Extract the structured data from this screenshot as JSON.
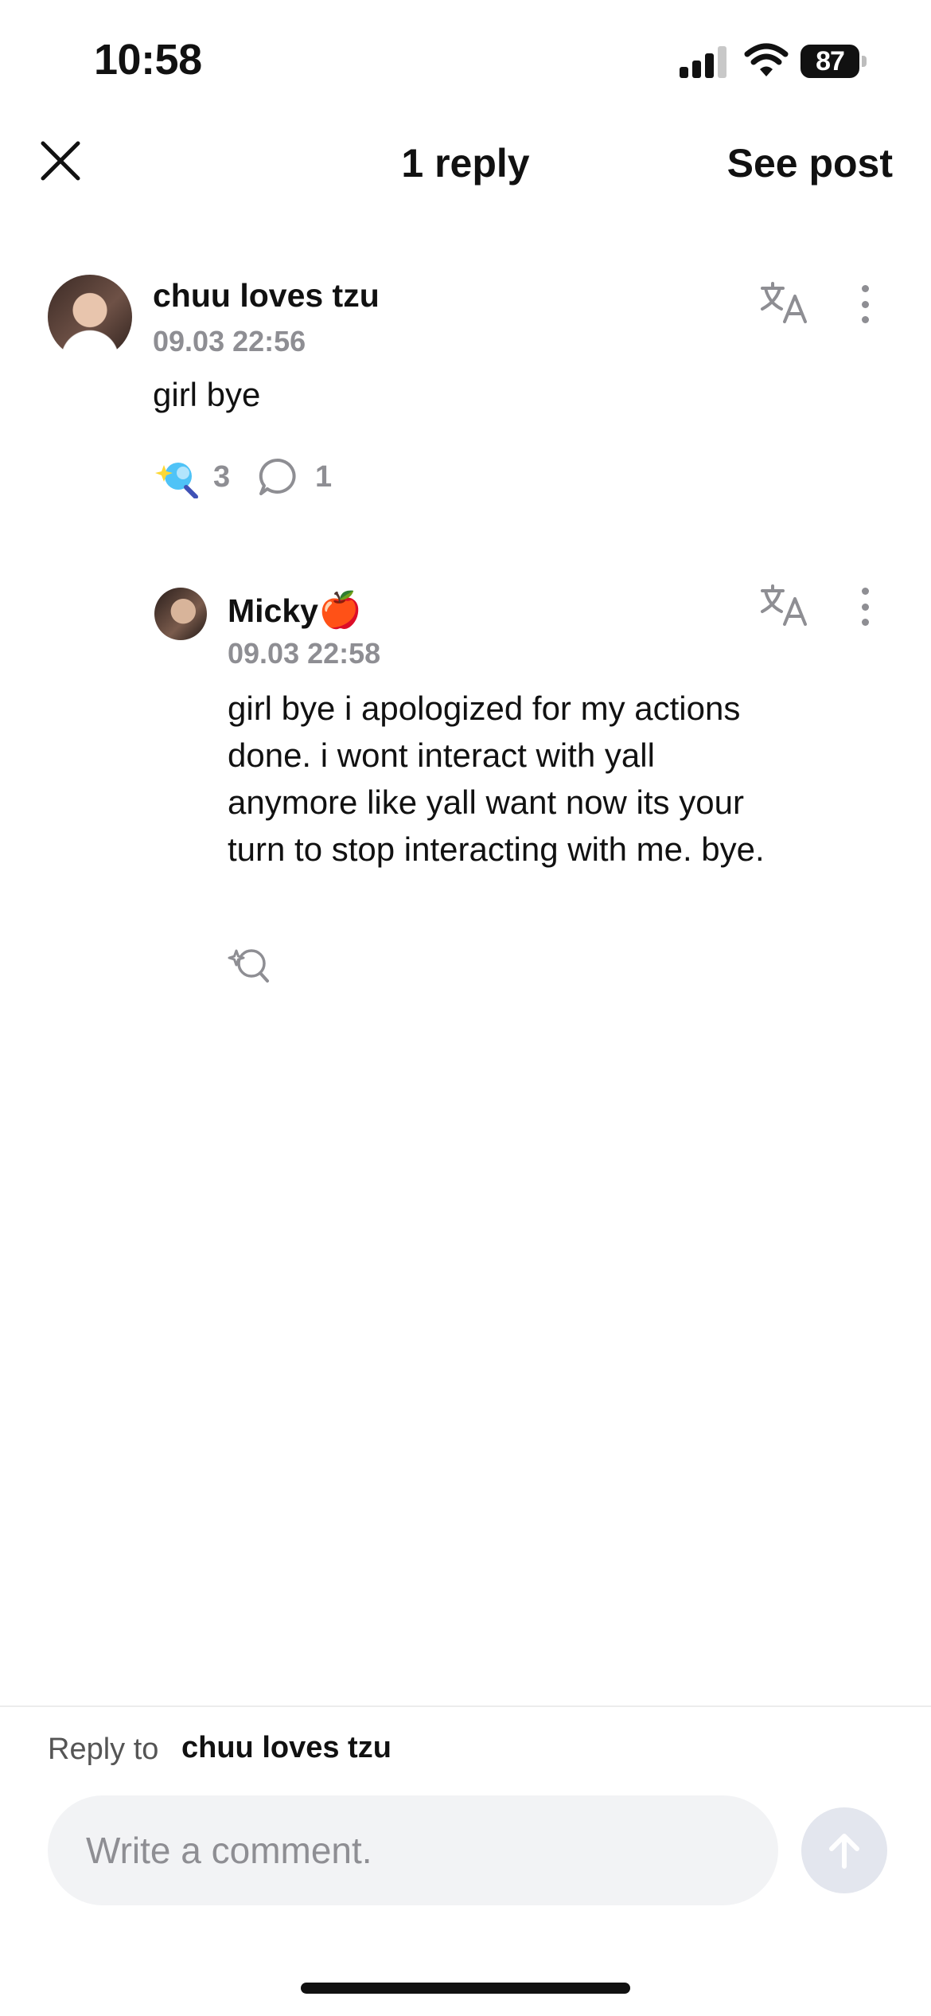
{
  "status_bar": {
    "time": "10:58",
    "battery": "87"
  },
  "header": {
    "title": "1 reply",
    "see_post": "See post"
  },
  "comment": {
    "username": "chuu loves tzu",
    "timestamp": "09.03 22:56",
    "text": "girl bye",
    "reaction_count": "3",
    "reply_count": "1"
  },
  "reply": {
    "username": "Micky",
    "username_emoji": "🍎",
    "timestamp": "09.03 22:58",
    "text_lines": [
      "girl bye i apologized for my actions",
      "done. i wont interact with yall",
      "anymore like yall want now its your",
      "turn to stop interacting with me. bye."
    ]
  },
  "composer": {
    "reply_prefix": "Reply to",
    "reply_target": "chuu loves tzu",
    "placeholder": "Write a comment."
  },
  "icons": {
    "close": "close-icon",
    "translate": "translate-icon",
    "more": "more-vertical-icon",
    "reaction": "sparkle-reaction-icon",
    "comment_bubble": "comment-bubble-icon",
    "add_reaction": "add-reaction-icon",
    "send": "arrow-up-icon"
  },
  "colors": {
    "muted": "#8e8e93",
    "send_disabled": "#e3e6ee",
    "input_bg": "#f2f3f5"
  }
}
